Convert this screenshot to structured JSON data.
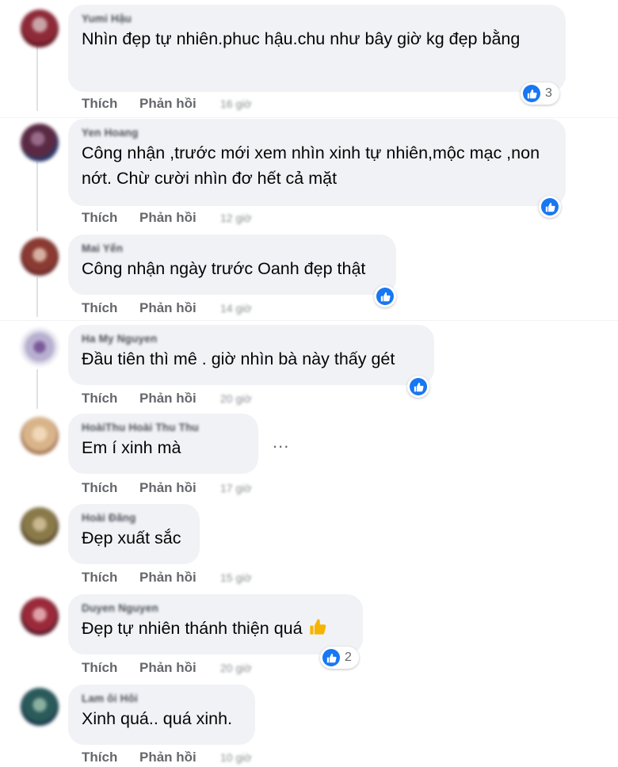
{
  "comments": [
    {
      "author": "Yumi Hậu",
      "text": "Nhìn đẹp tự nhiên.phuc hậu.chu như bây giờ kg đẹp bằng",
      "reaction_count": "3",
      "like": "Thích",
      "reply": "Phản hồi",
      "time": "16 giờ",
      "avatar_colors": [
        "#6b1d28",
        "#c9a3a8",
        "#8e2a38"
      ]
    },
    {
      "author": "Yen Hoang",
      "text": "Công nhận ,trước mới xem nhìn xinh tự nhiên,mộc mạc ,non nớt. Chừ cười nhìn đơ hết cả mặt",
      "reaction_count": "",
      "like": "Thích",
      "reply": "Phản hồi",
      "time": "12 giờ",
      "avatar_colors": [
        "#5a2a45",
        "#9a6a8a",
        "#2a3a6a"
      ]
    },
    {
      "author": "Mai Yến",
      "text": "Công nhận ngày trước Oanh đẹp thật",
      "reaction_count": "",
      "like": "Thích",
      "reply": "Phản hồi",
      "time": "14 giờ",
      "avatar_colors": [
        "#8a3a32",
        "#d7b0a0",
        "#6a2a2a"
      ]
    },
    {
      "author": "Ha My Nguyen",
      "text": "Đầu tiên thì mê . giờ nhìn bà này thấy gét",
      "reaction_count": "",
      "like": "Thích",
      "reply": "Phản hồi",
      "time": "20 giờ",
      "avatar_colors": [
        "#e6e6ef",
        "#7a5a9a",
        "#b9b0d0"
      ]
    },
    {
      "author": "HoàiThu Hoài Thu Thu",
      "text": "Em í xinh mà",
      "reaction_count": "",
      "like": "Thích",
      "reply": "Phản hồi",
      "time": "17 giờ",
      "avatar_colors": [
        "#d9b48a",
        "#f0d8b8",
        "#a87a5a"
      ]
    },
    {
      "author": "Hoài Đăng",
      "text": "Đẹp xuất sắc",
      "reaction_count": "",
      "like": "Thích",
      "reply": "Phản hồi",
      "time": "15 giờ",
      "avatar_colors": [
        "#8a7a4a",
        "#c9b890",
        "#5a4a2a"
      ]
    },
    {
      "author": "Duyen Nguyen",
      "text": "Đẹp tự nhiên thánh thiện quá",
      "reaction_count": "2",
      "like": "Thích",
      "reply": "Phản hồi",
      "time": "20 giờ",
      "avatar_colors": [
        "#9a2a3a",
        "#e0a0a8",
        "#5a1a2a"
      ]
    },
    {
      "author": "Lam ôi Hôi",
      "text": "Xinh quá.. quá xinh.",
      "reaction_count": "",
      "like": "Thích",
      "reply": "Phản hồi",
      "time": "10 giờ",
      "avatar_colors": [
        "#2a5a5a",
        "#8ab0a0",
        "#1a3a4a"
      ]
    }
  ],
  "more_menu": "...",
  "icons": {
    "reaction": "like-icon",
    "emoji": "thumbs-up-emoji-icon"
  },
  "colors": {
    "bubble": "#f0f2f5",
    "like_blue": "#1877f2",
    "action_gray": "#65676b"
  }
}
